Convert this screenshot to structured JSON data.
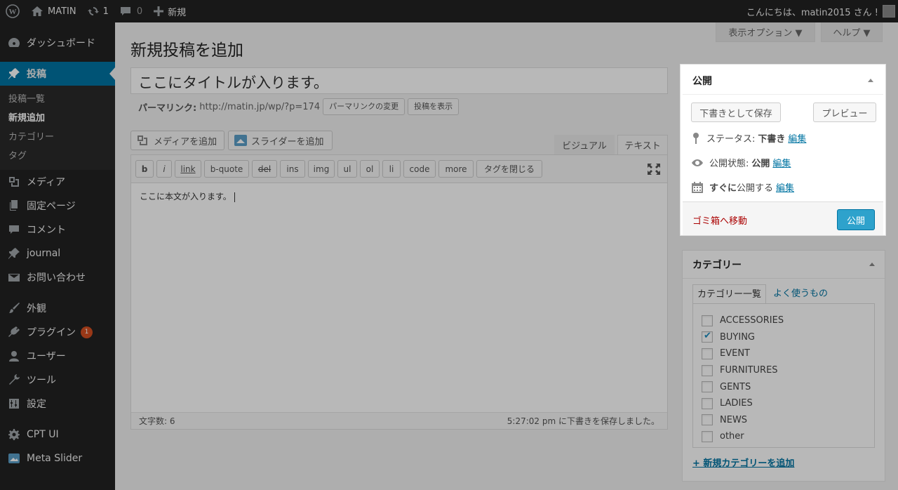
{
  "adminbar": {
    "site_name": "MATIN",
    "updates_count": "1",
    "comments_count": "0",
    "new_label": "新規",
    "greeting": "こんにちは、matin2015 さん !"
  },
  "sidebar": {
    "dashboard": "ダッシュボード",
    "posts": "投稿",
    "posts_sub": [
      "投稿一覧",
      "新規追加",
      "カテゴリー",
      "タグ"
    ],
    "media": "メディア",
    "pages": "固定ページ",
    "comments": "コメント",
    "journal": "journal",
    "contact": "お問い合わせ",
    "appearance": "外観",
    "plugins": "プラグイン",
    "plugins_badge": "1",
    "users": "ユーザー",
    "tools": "ツール",
    "settings": "設定",
    "cptui": "CPT UI",
    "metaslider": "Meta Slider"
  },
  "screen": {
    "options": "表示オプション ▼",
    "help": "ヘルプ ▼"
  },
  "main": {
    "page_title": "新規投稿を追加",
    "post_title": "ここにタイトルが入ります。",
    "permalink_label": "パーマリンク:",
    "permalink_url": "http://matin.jp/wp/?p=174",
    "change_permalink": "パーマリンクの変更",
    "view_post": "投稿を表示",
    "add_media": "メディアを追加",
    "add_slider": "スライダーを追加",
    "tab_visual": "ビジュアル",
    "tab_text": "テキスト",
    "quicktags": [
      "b",
      "i",
      "link",
      "b-quote",
      "del",
      "ins",
      "img",
      "ul",
      "ol",
      "li",
      "code",
      "more",
      "タグを閉じる"
    ],
    "content": "ここに本文が入ります。",
    "word_count": "文字数: 6",
    "draft_saved": "5:27:02 pm に下書きを保存しました。"
  },
  "publish": {
    "title": "公開",
    "save_draft": "下書きとして保存",
    "preview": "プレビュー",
    "status_label": "ステータス:",
    "status_value": "下書き",
    "visibility_label": "公開状態:",
    "visibility_value": "公開",
    "schedule_bold": "すぐに",
    "schedule_text": "公開する",
    "edit": "編集",
    "trash": "ゴミ箱へ移動",
    "publish_btn": "公開"
  },
  "categories": {
    "title": "カテゴリー",
    "tab_all": "カテゴリー一覧",
    "tab_popular": "よく使うもの",
    "items": [
      {
        "label": "ACCESSORIES",
        "checked": false
      },
      {
        "label": "BUYING",
        "checked": true
      },
      {
        "label": "EVENT",
        "checked": false
      },
      {
        "label": "FURNITURES",
        "checked": false
      },
      {
        "label": "GENTS",
        "checked": false
      },
      {
        "label": "LADIES",
        "checked": false
      },
      {
        "label": "NEWS",
        "checked": false
      },
      {
        "label": "other",
        "checked": false
      }
    ],
    "add_new": "+ 新規カテゴリーを追加"
  }
}
